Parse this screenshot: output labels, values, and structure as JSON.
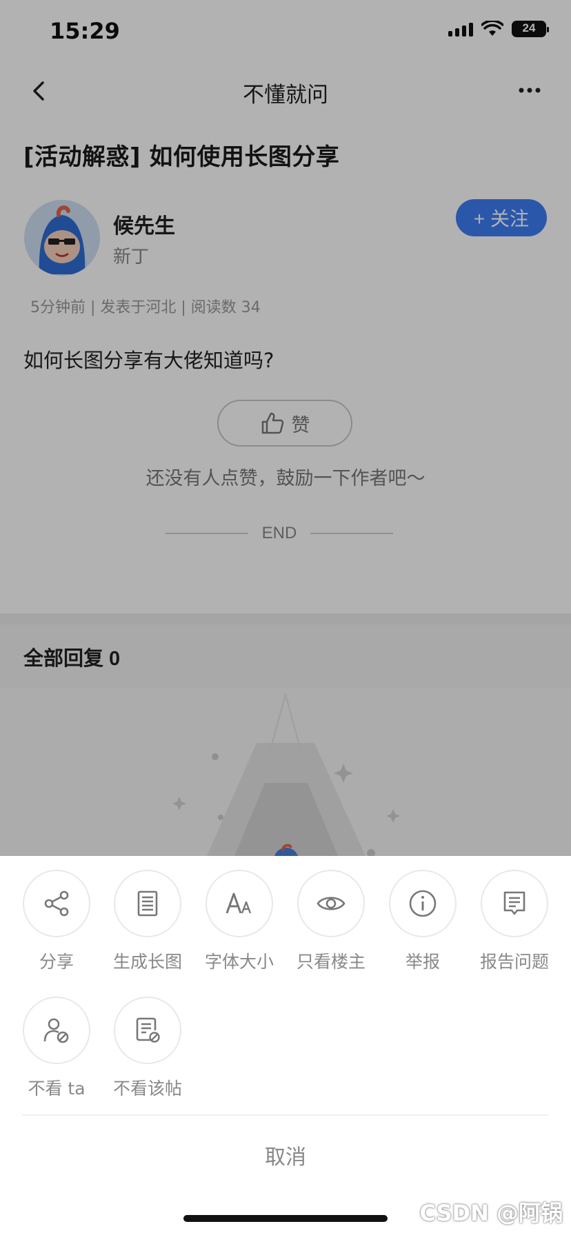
{
  "status_bar": {
    "time": "15:29",
    "battery": "24"
  },
  "nav": {
    "title": "不懂就问"
  },
  "post": {
    "title": "[活动解惑] 如何使用长图分享",
    "author": {
      "name": "候先生",
      "level": "新丁"
    },
    "follow_label": "+ 关注",
    "meta": "5分钟前 | 发表于河北 | 阅读数 34",
    "body": "如何长图分享有大佬知道吗?",
    "like_label": "赞",
    "like_hint": "还没有人点赞，鼓励一下作者吧～",
    "end_label": "END"
  },
  "replies": {
    "title": "全部回复",
    "count": "0"
  },
  "action_sheet": {
    "actions": [
      {
        "label": "分享",
        "icon": "share-icon"
      },
      {
        "label": "生成长图",
        "icon": "long-image-icon"
      },
      {
        "label": "字体大小",
        "icon": "font-size-icon"
      },
      {
        "label": "只看楼主",
        "icon": "eye-icon"
      },
      {
        "label": "举报",
        "icon": "info-icon"
      },
      {
        "label": "报告问题",
        "icon": "report-issue-icon"
      },
      {
        "label": "不看 ta",
        "icon": "block-user-icon"
      },
      {
        "label": "不看该帖",
        "icon": "block-post-icon"
      }
    ],
    "cancel_label": "取消"
  },
  "watermark": "CSDN @阿锅"
}
